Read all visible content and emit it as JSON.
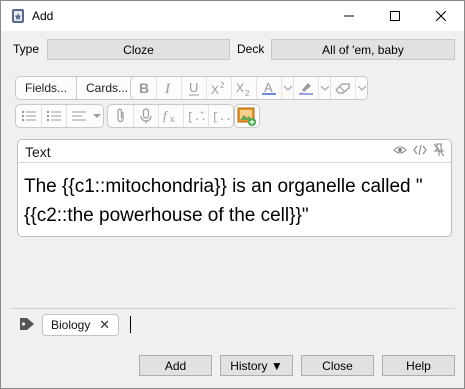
{
  "window": {
    "title": "Add"
  },
  "note_type": {
    "label": "Type",
    "value": "Cloze"
  },
  "deck": {
    "label": "Deck",
    "value": "All of 'em, baby"
  },
  "toolbar": {
    "fields_label": "Fields...",
    "cards_label": "Cards..."
  },
  "field": {
    "name": "Text",
    "content_line1": "The {{c1::mitochondria}} is an organelle called \"",
    "content_line2": "{{c2::the powerhouse of the cell}}\""
  },
  "tags": [
    {
      "label": "Biology",
      "remove": "✕"
    }
  ],
  "buttons": {
    "add": "Add",
    "history": "History ▼",
    "close": "Close",
    "help": "Help"
  },
  "colors": {
    "text_color_underline": "#6b8bd6",
    "highlight_underline": "#9e9ee6",
    "image_icon": "#e8932a"
  }
}
